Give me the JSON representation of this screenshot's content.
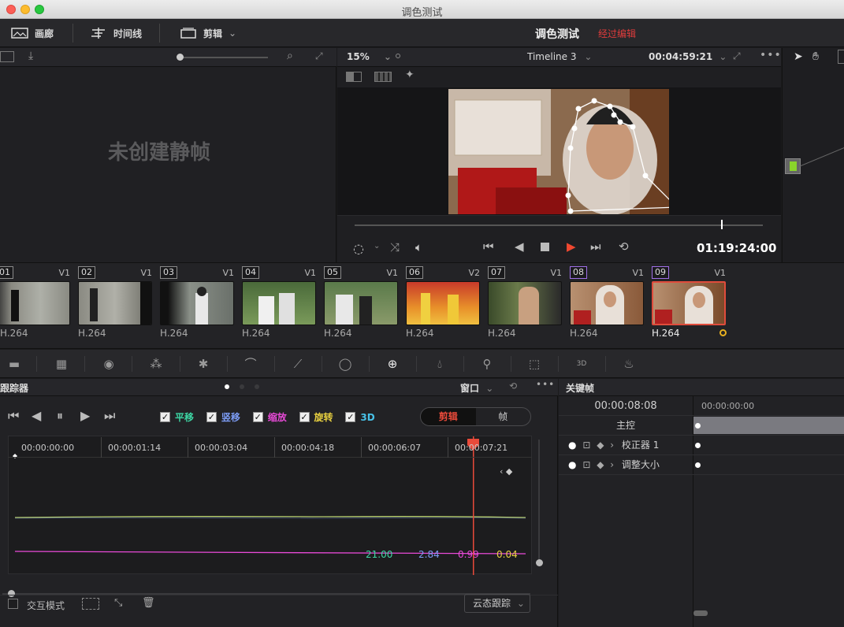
{
  "window": {
    "title": "调色测试"
  },
  "toolbar": {
    "gallery_label": "画廊",
    "timeline_label": "时间线",
    "clips_label": "剪辑",
    "project_title": "调色测试",
    "project_status": "经过编辑"
  },
  "gallery": {
    "empty_message": "未创建静帧"
  },
  "viewer": {
    "zoom": "15%",
    "timeline_name": "Timeline 3",
    "duration": "00:04:59:21",
    "timecode": "01:19:24:00"
  },
  "clips": [
    {
      "num": "01",
      "track": "V1",
      "codec": "H.264"
    },
    {
      "num": "02",
      "track": "V1",
      "codec": "H.264"
    },
    {
      "num": "03",
      "track": "V1",
      "codec": "H.264"
    },
    {
      "num": "04",
      "track": "V1",
      "codec": "H.264"
    },
    {
      "num": "05",
      "track": "V1",
      "codec": "H.264"
    },
    {
      "num": "06",
      "track": "V2",
      "codec": "H.264"
    },
    {
      "num": "07",
      "track": "V1",
      "codec": "H.264"
    },
    {
      "num": "08",
      "track": "V1",
      "codec": "H.264"
    },
    {
      "num": "09",
      "track": "V1",
      "codec": "H.264"
    }
  ],
  "tracker": {
    "title": "跟踪器",
    "window_dropdown": "窗口",
    "options": [
      {
        "label": "平移",
        "color": "#3dd6a4"
      },
      {
        "label": "竖移",
        "color": "#7c9cf4"
      },
      {
        "label": "缩放",
        "color": "#e94ad8"
      },
      {
        "label": "旋转",
        "color": "#e8d040"
      },
      {
        "label": "3D",
        "color": "#48c2e8"
      }
    ],
    "mode_clip": "剪辑",
    "mode_frame": "帧",
    "ruler": [
      "00:00:00:00",
      "00:00:01:14",
      "00:00:03:04",
      "00:00:04:18",
      "00:00:06:07",
      "00:00:07:21"
    ],
    "values": [
      {
        "value": "21.00",
        "color": "#3dd6a4"
      },
      {
        "value": "2.84",
        "color": "#7c9cf4"
      },
      {
        "value": "0.99",
        "color": "#e94ad8"
      },
      {
        "value": "0.04",
        "color": "#e8d040"
      }
    ],
    "interactive_mode": "交互模式",
    "tracking_mode": "云态跟踪"
  },
  "keyframes": {
    "title": "关键帧",
    "current_tc": "00:00:08:08",
    "start_tc": "00:00:00:00",
    "master": "主控",
    "rows": [
      "校正器 1",
      "调整大小"
    ]
  }
}
